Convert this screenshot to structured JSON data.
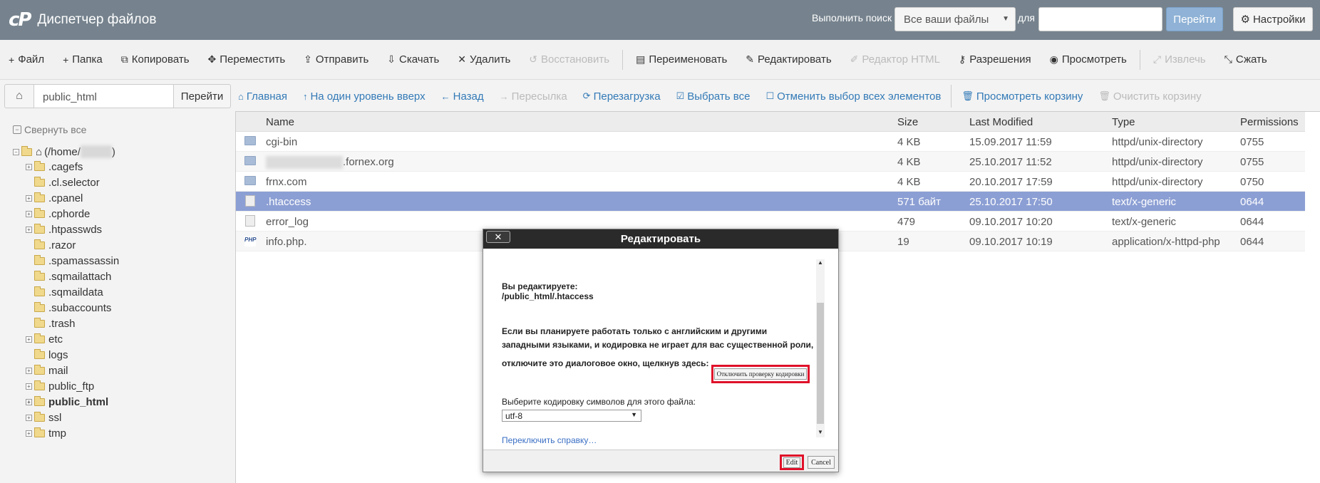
{
  "header": {
    "logo_mark": "cP",
    "title": "Диспетчер файлов",
    "search_label": "Выполнить поиск",
    "search_scope": "Все ваши файлы",
    "for_label": "для",
    "search_value": "",
    "go_label": "Перейти",
    "settings_label": "Настройки"
  },
  "toolbar": [
    {
      "label": "Файл",
      "icon": "+",
      "name": "file",
      "disabled": false
    },
    {
      "label": "Папка",
      "icon": "+",
      "name": "folder",
      "disabled": false
    },
    {
      "label": "Копировать",
      "icon": "⧉",
      "name": "copy",
      "disabled": false
    },
    {
      "label": "Переместить",
      "icon": "✥",
      "name": "move",
      "disabled": false
    },
    {
      "label": "Отправить",
      "icon": "⇪",
      "name": "upload",
      "disabled": false
    },
    {
      "label": "Скачать",
      "icon": "⇩",
      "name": "download",
      "disabled": false
    },
    {
      "label": "Удалить",
      "icon": "✕",
      "name": "delete",
      "disabled": false
    },
    {
      "label": "Восстановить",
      "icon": "↺",
      "name": "restore",
      "disabled": true
    },
    {
      "label": "Переименовать",
      "icon": "▤",
      "name": "rename",
      "disabled": false
    },
    {
      "label": "Редактировать",
      "icon": "✎",
      "name": "edit",
      "disabled": false
    },
    {
      "label": "Редактор HTML",
      "icon": "✐",
      "name": "html-editor",
      "disabled": true
    },
    {
      "label": "Разрешения",
      "icon": "⚷",
      "name": "permissions",
      "disabled": false
    },
    {
      "label": "Просмотреть",
      "icon": "◉",
      "name": "view",
      "disabled": false
    },
    {
      "label": "Извлечь",
      "icon": "⤢",
      "name": "extract",
      "disabled": true
    },
    {
      "label": "Сжать",
      "icon": "⤡",
      "name": "compress",
      "disabled": false
    }
  ],
  "pathbar": {
    "path": "public_html",
    "go_label": "Перейти"
  },
  "nav": [
    {
      "label": "Главная",
      "icon": "⌂",
      "name": "home",
      "disabled": false
    },
    {
      "label": "На один уровень вверх",
      "icon": "↑",
      "name": "up-one-level",
      "disabled": false
    },
    {
      "label": "Назад",
      "icon": "←",
      "name": "back",
      "disabled": false
    },
    {
      "label": "Пересылка",
      "icon": "→",
      "name": "forward",
      "disabled": true
    },
    {
      "label": "Перезагрузка",
      "icon": "⟳",
      "name": "reload",
      "disabled": false
    },
    {
      "label": "Выбрать все",
      "icon": "☑",
      "name": "select-all",
      "disabled": false
    },
    {
      "label": "Отменить выбор всех элементов",
      "icon": "☐",
      "name": "unselect-all",
      "disabled": false
    },
    {
      "label": "Просмотреть корзину",
      "icon": "🗑",
      "name": "view-trash",
      "disabled": false
    },
    {
      "label": "Очистить корзину",
      "icon": "🗑",
      "name": "empty-trash",
      "disabled": true
    }
  ],
  "sidebar": {
    "collapse_all": "Свернуть все",
    "root_prefix": "(/home/",
    "root_suffix": ")",
    "items": [
      {
        "label": ".cagefs",
        "expandable": true,
        "bold": false
      },
      {
        "label": ".cl.selector",
        "expandable": false,
        "bold": false
      },
      {
        "label": ".cpanel",
        "expandable": true,
        "bold": false
      },
      {
        "label": ".cphorde",
        "expandable": true,
        "bold": false
      },
      {
        "label": ".htpasswds",
        "expandable": true,
        "bold": false
      },
      {
        "label": ".razor",
        "expandable": false,
        "bold": false
      },
      {
        "label": ".spamassassin",
        "expandable": false,
        "bold": false
      },
      {
        "label": ".sqmailattach",
        "expandable": false,
        "bold": false
      },
      {
        "label": ".sqmaildata",
        "expandable": false,
        "bold": false
      },
      {
        "label": ".subaccounts",
        "expandable": false,
        "bold": false
      },
      {
        "label": ".trash",
        "expandable": false,
        "bold": false
      },
      {
        "label": "etc",
        "expandable": true,
        "bold": false
      },
      {
        "label": "logs",
        "expandable": false,
        "bold": false
      },
      {
        "label": "mail",
        "expandable": true,
        "bold": false
      },
      {
        "label": "public_ftp",
        "expandable": true,
        "bold": false
      },
      {
        "label": "public_html",
        "expandable": true,
        "bold": true
      },
      {
        "label": "ssl",
        "expandable": true,
        "bold": false
      },
      {
        "label": "tmp",
        "expandable": true,
        "bold": false
      }
    ]
  },
  "table": {
    "headers": {
      "name": "Name",
      "size": "Size",
      "modified": "Last Modified",
      "type": "Type",
      "perms": "Permissions"
    },
    "rows": [
      {
        "icon": "dir",
        "name": "cgi-bin",
        "blurred_prefix": false,
        "size": "4 KB",
        "modified": "15.09.2017 11:59",
        "type": "httpd/unix-directory",
        "perms": "0755",
        "selected": false
      },
      {
        "icon": "dir",
        "name": ".fornex.org",
        "blurred_prefix": true,
        "size": "4 KB",
        "modified": "25.10.2017 11:52",
        "type": "httpd/unix-directory",
        "perms": "0755",
        "selected": false
      },
      {
        "icon": "dir",
        "name": "frnx.com",
        "blurred_prefix": false,
        "size": "4 KB",
        "modified": "20.10.2017 17:59",
        "type": "httpd/unix-directory",
        "perms": "0750",
        "selected": false
      },
      {
        "icon": "file",
        "name": ".htaccess",
        "blurred_prefix": false,
        "size": "571 байт",
        "modified": "25.10.2017 17:50",
        "type": "text/x-generic",
        "perms": "0644",
        "selected": true
      },
      {
        "icon": "file",
        "name": "error_log",
        "blurred_prefix": false,
        "size": "479",
        "modified": "09.10.2017 10:20",
        "type": "text/x-generic",
        "perms": "0644",
        "selected": false
      },
      {
        "icon": "php",
        "name": "info.php.",
        "blurred_prefix": false,
        "size": "19",
        "modified": "09.10.2017 10:19",
        "type": "application/x-httpd-php",
        "perms": "0644",
        "selected": false
      }
    ]
  },
  "modal": {
    "title": "Редактировать",
    "close_label": "✕",
    "editing_label": "Вы редактируете:",
    "editing_path": "/public_html/.htaccess",
    "notice_line1": "Если вы планируете работать только с английским и другими",
    "notice_line2": "западными языками, и кодировка не играет для вас существенной роли,",
    "notice_line3": "отключите это диалоговое окно, щелкнув здесь:",
    "disable_check_label": "Отключить проверку кодировки",
    "encoding_prompt": "Выберите кодировку символов для этого файла:",
    "encoding_value": "utf-8",
    "toggle_help": "Переключить справку…",
    "edit_label": "Edit",
    "cancel_label": "Cancel"
  },
  "colors": {
    "header_bg": "#76838e",
    "selected_row": "#8c9fd4",
    "link": "#337ab7",
    "highlight": "#e0112a"
  }
}
